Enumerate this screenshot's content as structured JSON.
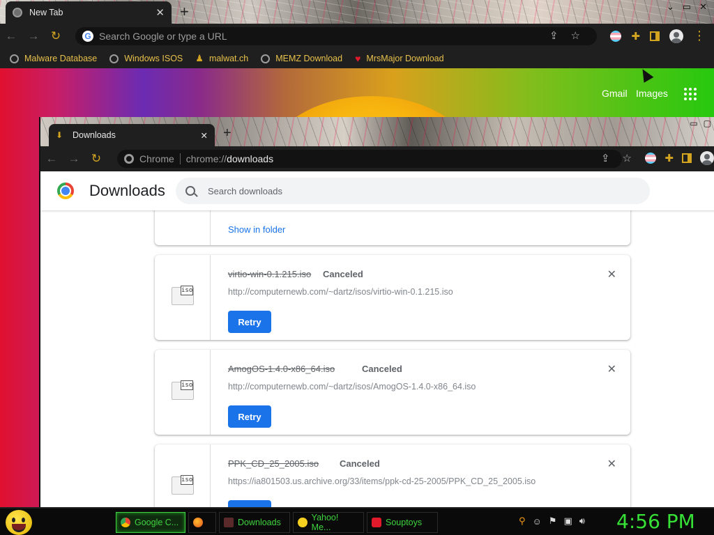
{
  "outer_browser": {
    "tab_title": "New Tab",
    "tab_close": "✕",
    "new_tab": "+",
    "window_controls": [
      "⌄",
      "▭",
      "✕"
    ],
    "omnibox_placeholder": "Search Google or type a URL",
    "bookmarks": [
      {
        "label": "Malware Database",
        "icon": "globe-icon"
      },
      {
        "label": "Windows ISOS",
        "icon": "globe-icon"
      },
      {
        "label": "malwat.ch",
        "icon": "person-icon"
      },
      {
        "label": "MEMZ Download",
        "icon": "globe-icon"
      },
      {
        "label": "MrsMajor Download",
        "icon": "heart-icon"
      }
    ],
    "ntp_links": {
      "gmail": "Gmail",
      "images": "Images"
    }
  },
  "downloads_window": {
    "tab_title": "Downloads",
    "tab_close": "✕",
    "new_tab": "+",
    "window_controls": [
      "▭",
      "▢"
    ],
    "url_chip": "Chrome",
    "url_scheme": "chrome://",
    "url_host": "downloads",
    "page_title": "Downloads",
    "search_placeholder": "Search downloads",
    "show_in_folder": "Show in folder",
    "items": [
      {
        "filename": "virtio-win-0.1.215.iso",
        "status": "Canceled",
        "url": "http://computernewb.com/~dartz/isos/virtio-win-0.1.215.iso",
        "action": "Retry",
        "icon_label": "iso"
      },
      {
        "filename": "AmogOS-1.4.0-x86_64.iso",
        "status": "Canceled",
        "url": "http://computernewb.com/~dartz/isos/AmogOS-1.4.0-x86_64.iso",
        "action": "Retry",
        "icon_label": "iso"
      },
      {
        "filename": "PPK_CD_25_2005.iso",
        "status": "Canceled",
        "url": "https://ia801503.us.archive.org/33/items/ppk-cd-25-2005/PPK_CD_25_2005.iso",
        "action": "Retry",
        "icon_label": "iso"
      }
    ]
  },
  "taskbar": {
    "tasks": [
      {
        "label": "Google C...",
        "icon": "chrome-icon",
        "active": true
      },
      {
        "label": "",
        "icon": "firefox-icon",
        "active": false
      },
      {
        "label": "Downloads",
        "icon": "downloads-icon",
        "active": false
      },
      {
        "label": "Yahoo! Me...",
        "icon": "yahoo-messenger-icon",
        "active": false
      },
      {
        "label": "Souptoys",
        "icon": "souptoys-icon",
        "active": false
      }
    ],
    "clock": "4:56 PM"
  },
  "colors": {
    "accent_gold": "#d4a521",
    "retry_blue": "#1a73e8",
    "taskbar_green": "#3fd43f"
  }
}
